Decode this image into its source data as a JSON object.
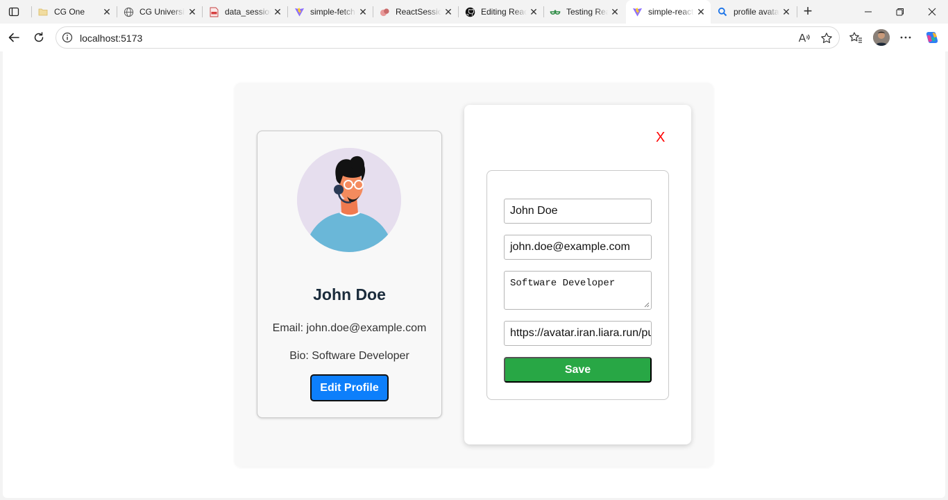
{
  "browser": {
    "tabs": [
      {
        "title": "CG One",
        "icon": "folder-icon"
      },
      {
        "title": "CG University",
        "icon": "globe-icon"
      },
      {
        "title": "data_session",
        "icon": "pdf-icon"
      },
      {
        "title": "simple-fetch",
        "icon": "vite-icon"
      },
      {
        "title": "ReactSession",
        "icon": "slides-icon"
      },
      {
        "title": "Editing React",
        "icon": "github-icon"
      },
      {
        "title": "Testing React",
        "icon": "geeksforgeeks-icon"
      },
      {
        "title": "simple-react",
        "icon": "vite-icon",
        "active": true
      },
      {
        "title": "profile avatar",
        "icon": "search-icon"
      }
    ],
    "close_glyph": "✕",
    "new_tab_glyph": "+",
    "address": "localhost:5173"
  },
  "profile": {
    "name": "John Doe",
    "email_text": "Email: john.doe@example.com",
    "bio_text": "Bio: Software Developer",
    "edit_label": "Edit Profile"
  },
  "modal": {
    "close_label": "X",
    "name_value": "John Doe",
    "email_value": "john.doe@example.com",
    "bio_value": "Software Developer",
    "avatar_value": "https://avatar.iran.liara.run/public",
    "save_label": "Save"
  },
  "colors": {
    "primary_button": "#0d7ffb",
    "save_button": "#28a745",
    "close_x": "#ff0000",
    "avatar_bg": "#e6deee"
  }
}
